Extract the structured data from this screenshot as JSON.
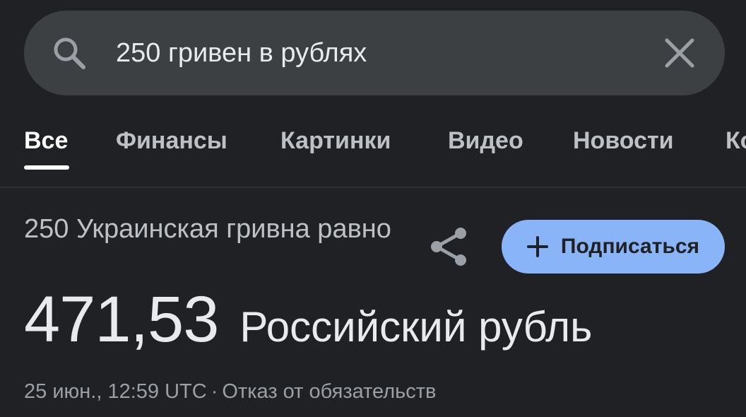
{
  "search": {
    "query": "250 гривен в рублях"
  },
  "tabs": [
    {
      "label": "Все",
      "active": true
    },
    {
      "label": "Финансы"
    },
    {
      "label": "Картинки"
    },
    {
      "label": "Видео"
    },
    {
      "label": "Новости"
    },
    {
      "label": "Ко"
    }
  ],
  "converter": {
    "from_text": "250 Украинская гривна равно",
    "result_value": "471,53",
    "result_currency": "Российский рубль",
    "subscribe_label": "Подписаться",
    "timestamp": "25 июн., 12:59 UTC",
    "separator": "·",
    "disclaimer": "Отказ от обязательств"
  },
  "icons": {
    "search": "search-icon",
    "clear": "close-icon",
    "share": "share-icon",
    "plus": "plus-icon"
  },
  "colors": {
    "background": "#202124",
    "search_bar": "#3c4043",
    "accent": "#8ab4f8",
    "text_primary": "#e8eaed",
    "text_secondary": "#9aa0a6"
  }
}
